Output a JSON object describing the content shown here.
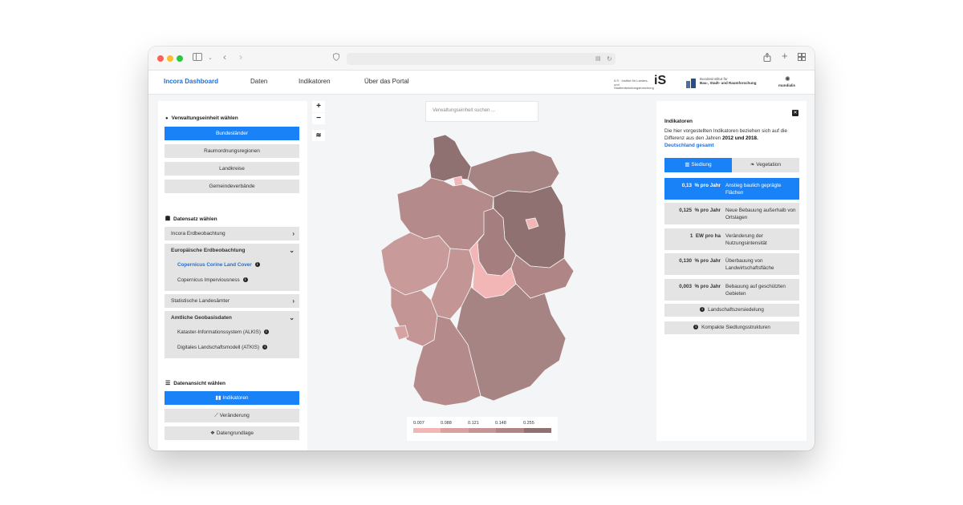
{
  "nav": {
    "brand": "Incora Dashboard",
    "links": [
      "Daten",
      "Indikatoren",
      "Über das Portal"
    ]
  },
  "logos": {
    "ils_text": "ILS · Institut für Landes- und Stadtentwicklungsforschung",
    "ils_mark": "iS",
    "bbsr_line1": "Bundesinstitut für",
    "bbsr_line2": "Bau-, Stadt- und Raumforschung",
    "mundialis": "mundialis"
  },
  "left": {
    "unit_title": "Verwaltungseinheit wählen",
    "units": [
      "Bundesländer",
      "Raumordnungsregionen",
      "Landkreise",
      "Gemeindeverbände"
    ],
    "dataset_title": "Datensatz wählen",
    "datasets": {
      "incora": "Incora Erdbeobachtung",
      "eu": "Europäische Erdbeobachtung",
      "eu_items": [
        "Copernicus Corine Land Cover",
        "Copernicus Imperviousness"
      ],
      "stat": "Statistische Landesämter",
      "official": "Amtliche Geobasisdaten",
      "official_items": [
        "Kataster-Informationssystem (ALKIS)",
        "Digitales Landschaftsmodell (ATKIS)"
      ]
    },
    "view_title": "Datenansicht wählen",
    "views": [
      "Indikatoren",
      "Veränderung",
      "Datengrundlage"
    ]
  },
  "search": {
    "placeholder": "Verwaltungseinheit suchen ..."
  },
  "legend": {
    "ticks": [
      "0.007",
      "0.088",
      "0.121",
      "0.148",
      "0.255"
    ],
    "colors": [
      "#f2b6b6",
      "#d9a2a2",
      "#c59494",
      "#b08585",
      "#8f7171"
    ]
  },
  "right": {
    "title": "Indikatoren",
    "desc_pre": "Die hier vorgestellten Indikatoren beziehen sich auf die Differenz aus den Jahren ",
    "desc_years": "2012 und 2018.",
    "desc_scope": "Deutschland gesamt",
    "tabs": [
      "Siedlung",
      "Vegetation"
    ],
    "indicators": [
      {
        "value": "0,13",
        "unit": "% pro Jahr",
        "label": "Anstieg baulich geprägte Flächen"
      },
      {
        "value": "0,125",
        "unit": "% pro Jahr",
        "label": "Neue Bebauung außerhalb von Ortslagen"
      },
      {
        "value": "1",
        "unit": "EW pro ha",
        "label": "Veränderung der Nutzungsintensität"
      },
      {
        "value": "0,130",
        "unit": "% pro Jahr",
        "label": "Überbauung von Landwirtschaftsfläche"
      },
      {
        "value": "0,003",
        "unit": "% pro Jahr",
        "label": "Bebauung auf geschützten Gebieten"
      }
    ],
    "extra": [
      "Landschaftszersiedelung",
      "Kompakte Siedlungsstrukturen"
    ]
  },
  "colors": {
    "accent": "#1a82f7"
  }
}
